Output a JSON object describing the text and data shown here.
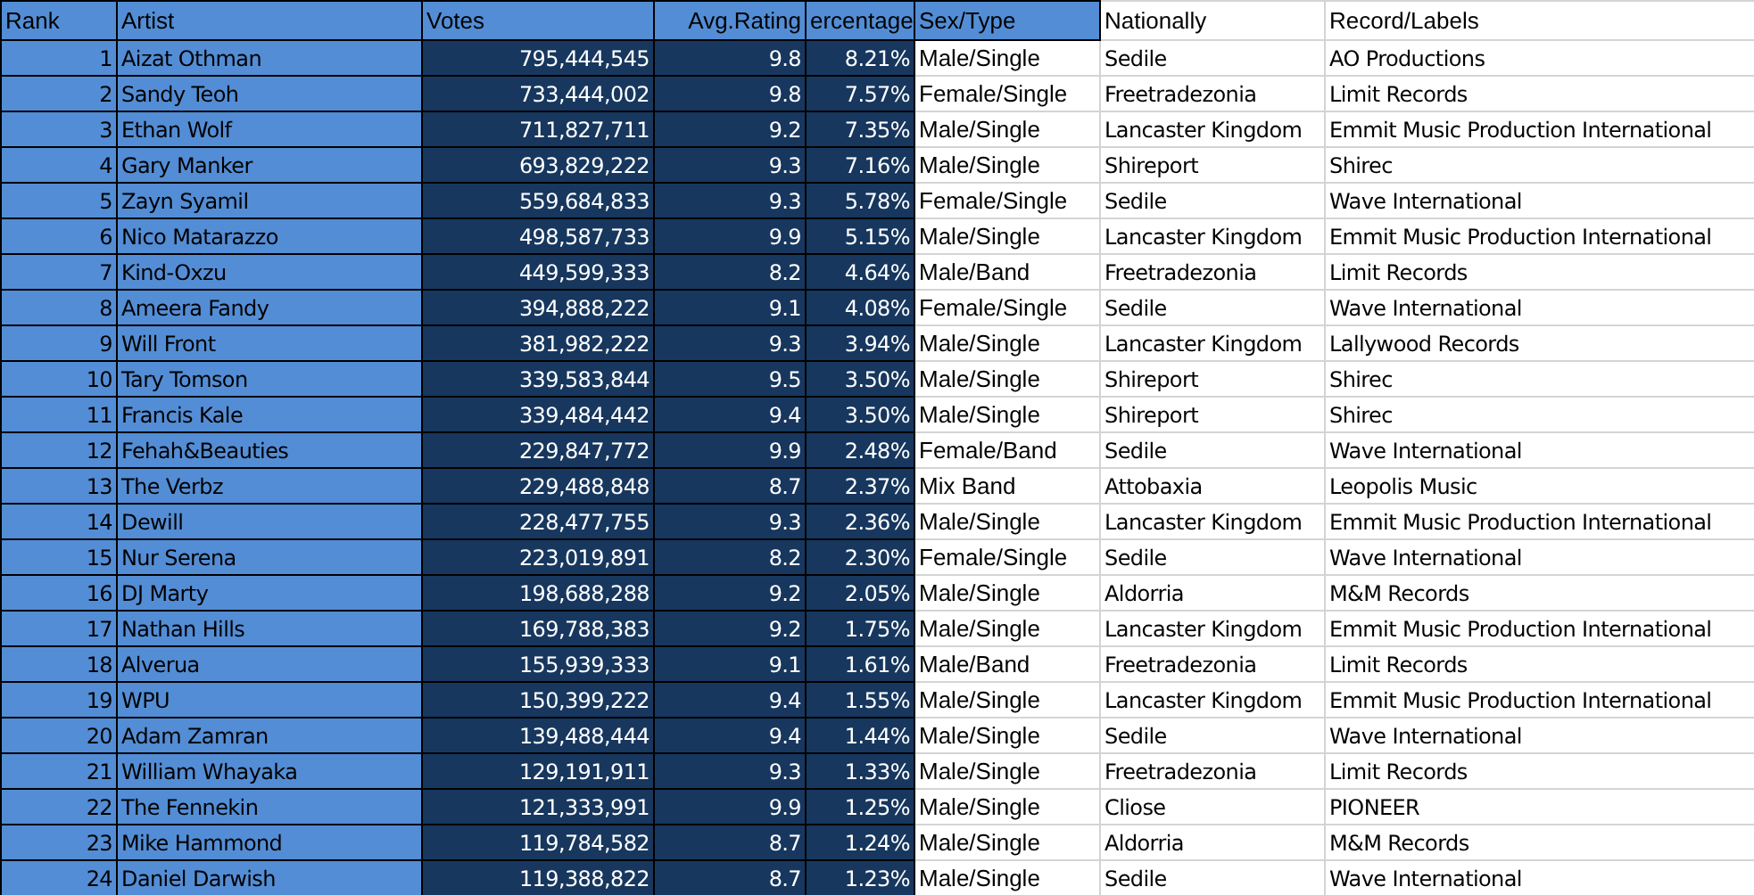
{
  "table": {
    "columns": [
      "Rank",
      "Artist",
      "Votes",
      "Avg.Rating",
      "ercentage",
      "Sex/Type",
      "Nationally",
      "Record/Labels"
    ],
    "rows": [
      [
        "1",
        "Aizat Othman",
        "795,444,545",
        "9.8",
        "8.21%",
        "Male/Single",
        "Sedile",
        "AO Productions"
      ],
      [
        "2",
        "Sandy Teoh",
        "733,444,002",
        "9.8",
        "7.57%",
        "Female/Single",
        "Freetradezonia",
        "Limit Records"
      ],
      [
        "3",
        "Ethan Wolf",
        "711,827,711",
        "9.2",
        "7.35%",
        "Male/Single",
        "Lancaster Kingdom",
        "Emmit Music Production International"
      ],
      [
        "4",
        "Gary Manker",
        "693,829,222",
        "9.3",
        "7.16%",
        "Male/Single",
        "Shireport",
        "Shirec"
      ],
      [
        "5",
        "Zayn Syamil",
        "559,684,833",
        "9.3",
        "5.78%",
        "Female/Single",
        "Sedile",
        "Wave International"
      ],
      [
        "6",
        "Nico Matarazzo",
        "498,587,733",
        "9.9",
        "5.15%",
        "Male/Single",
        "Lancaster Kingdom",
        "Emmit Music Production International"
      ],
      [
        "7",
        "Kind-Oxzu",
        "449,599,333",
        "8.2",
        "4.64%",
        "Male/Band",
        "Freetradezonia",
        "Limit Records"
      ],
      [
        "8",
        "Ameera Fandy",
        "394,888,222",
        "9.1",
        "4.08%",
        "Female/Single",
        "Sedile",
        "Wave International"
      ],
      [
        "9",
        "Will Front",
        "381,982,222",
        "9.3",
        "3.94%",
        "Male/Single",
        "Lancaster Kingdom",
        "Lallywood Records"
      ],
      [
        "10",
        "Tary Tomson",
        "339,583,844",
        "9.5",
        "3.50%",
        "Male/Single",
        "Shireport",
        "Shirec"
      ],
      [
        "11",
        "Francis Kale",
        "339,484,442",
        "9.4",
        "3.50%",
        "Male/Single",
        "Shireport",
        "Shirec"
      ],
      [
        "12",
        "Fehah&Beauties",
        "229,847,772",
        "9.9",
        "2.48%",
        "Female/Band",
        "Sedile",
        "Wave International"
      ],
      [
        "13",
        "The Verbz",
        "229,488,848",
        "8.7",
        "2.37%",
        "Mix Band",
        "Attobaxia",
        "Leopolis Music"
      ],
      [
        "14",
        "Dewill",
        "228,477,755",
        "9.3",
        "2.36%",
        "Male/Single",
        "Lancaster Kingdom",
        "Emmit Music Production International"
      ],
      [
        "15",
        "Nur Serena",
        "223,019,891",
        "8.2",
        "2.30%",
        "Female/Single",
        "Sedile",
        "Wave International"
      ],
      [
        "16",
        "DJ Marty",
        "198,688,288",
        "9.2",
        "2.05%",
        "Male/Single",
        "Aldorria",
        "M&M Records"
      ],
      [
        "17",
        "Nathan Hills",
        "169,788,383",
        "9.2",
        "1.75%",
        "Male/Single",
        "Lancaster Kingdom",
        "Emmit Music Production International"
      ],
      [
        "18",
        "Alverua",
        "155,939,333",
        "9.1",
        "1.61%",
        "Male/Band",
        "Freetradezonia",
        "Limit Records"
      ],
      [
        "19",
        "WPU",
        "150,399,222",
        "9.4",
        "1.55%",
        "Male/Single",
        "Lancaster Kingdom",
        "Emmit Music Production International"
      ],
      [
        "20",
        "Adam Zamran",
        "139,488,444",
        "9.4",
        "1.44%",
        "Male/Single",
        "Sedile",
        "Wave International"
      ],
      [
        "21",
        "William Whayaka",
        "129,191,911",
        "9.3",
        "1.33%",
        "Male/Single",
        "Freetradezonia",
        "Limit Records"
      ],
      [
        "22",
        "The Fennekin",
        "121,333,991",
        "9.9",
        "1.25%",
        "Male/Single",
        "Cliose",
        "PIONEER"
      ],
      [
        "23",
        "Mike Hammond",
        "119,784,582",
        "8.7",
        "1.24%",
        "Male/Single",
        "Aldorria",
        "M&M Records"
      ],
      [
        "24",
        "Daniel Darwish",
        "119,388,822",
        "8.7",
        "1.23%",
        "Male/Single",
        "Sedile",
        "Wave International"
      ]
    ]
  }
}
